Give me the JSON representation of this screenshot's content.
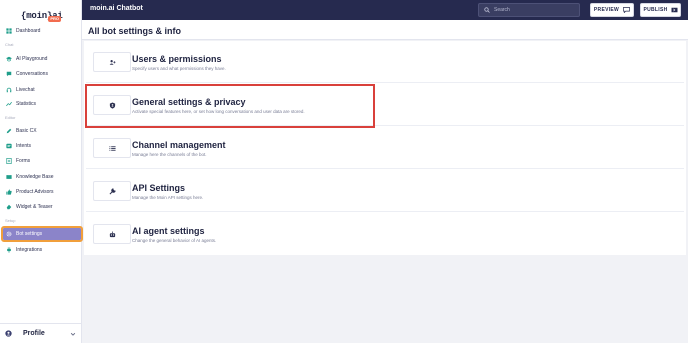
{
  "logo": {
    "text": "{moin}ai",
    "badge": "PRO"
  },
  "sidebar": {
    "items_top": [
      {
        "label": "Dashboard",
        "icon": "dashboard-icon"
      }
    ],
    "section_chat": "Chat",
    "items_chat": [
      {
        "label": "AI Playground",
        "icon": "graduation-cap-icon"
      },
      {
        "label": "Conversations",
        "icon": "chat-bubble-icon"
      },
      {
        "label": "Livechat",
        "icon": "headset-icon"
      },
      {
        "label": "Statistics",
        "icon": "chart-line-icon"
      }
    ],
    "section_editor": "Editor",
    "items_editor": [
      {
        "label": "Basic CX",
        "icon": "pencil-icon"
      },
      {
        "label": "Intents",
        "icon": "intents-icon"
      },
      {
        "label": "Forms",
        "icon": "form-icon"
      },
      {
        "label": "Knowledge Base",
        "icon": "book-icon"
      },
      {
        "label": "Product Advisors",
        "icon": "thumbs-up-icon"
      },
      {
        "label": "Widget & Teaser",
        "icon": "widget-icon"
      }
    ],
    "section_setup": "Setup",
    "items_setup": [
      {
        "label": "Bot settings",
        "icon": "gear-icon",
        "active": true
      },
      {
        "label": "Integrations",
        "icon": "plug-icon"
      }
    ],
    "footer": {
      "label": "Profile"
    }
  },
  "topbar": {
    "title": "moin.ai Chatbot",
    "search_placeholder": "Search",
    "preview_label": "PREVIEW",
    "publish_label": "PUBLISH"
  },
  "page": {
    "title": "All bot settings & info"
  },
  "cards": [
    {
      "title": "Users & permissions",
      "description": "Specify users and what permissions they have.",
      "icon": "users-icon"
    },
    {
      "title": "General settings & privacy",
      "description": "Activate special features here, or set how long conversations and user data are stored.",
      "icon": "shield-user-icon"
    },
    {
      "title": "Channel management",
      "description": "Manage here the channels of the bot.",
      "icon": "list-icon"
    },
    {
      "title": "API Settings",
      "description": "Manage the Moin API settings here.",
      "icon": "wrench-icon"
    },
    {
      "title": "AI agent settings",
      "description": "Change the general behavior of AI agents.",
      "icon": "robot-icon"
    }
  ],
  "colors": {
    "topbar": "#262a4f",
    "active_nav": "#8b84c9",
    "active_outline": "#f19f3b",
    "highlight": "#d9403b",
    "badge": "#f26c4f"
  }
}
